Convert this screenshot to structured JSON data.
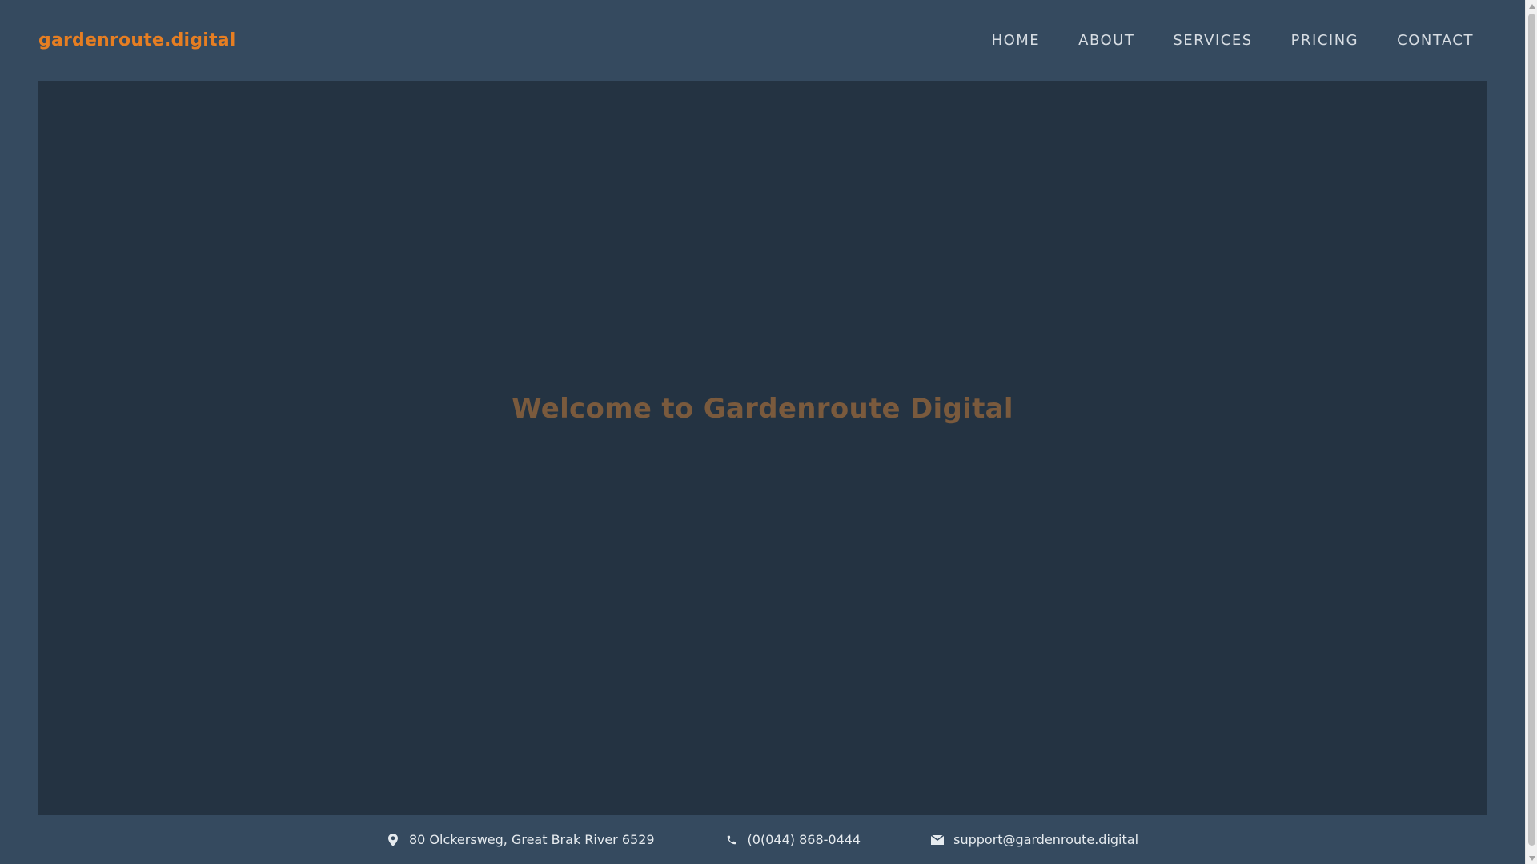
{
  "brand": {
    "name": "gardenroute.digital",
    "color": "#e67e22"
  },
  "nav": {
    "items": [
      {
        "label": "HOME"
      },
      {
        "label": "ABOUT"
      },
      {
        "label": "SERVICES"
      },
      {
        "label": "PRICING"
      },
      {
        "label": "CONTACT"
      }
    ]
  },
  "hero": {
    "title": "Welcome to Gardenroute Digital",
    "background": "#243342",
    "title_color": "#7a5a3d"
  },
  "contact": {
    "address": {
      "icon": "map-pin-icon",
      "text": "80 Olckersweg, Great Brak River 6529"
    },
    "phone": {
      "icon": "phone-icon",
      "text": "(0(044) 868-0444"
    },
    "email": {
      "icon": "mail-icon",
      "text": "support@gardenroute.digital"
    }
  },
  "colors": {
    "page_background": "#354a5f",
    "nav_text": "#d7dde3",
    "contact_text": "#e6ebef"
  }
}
